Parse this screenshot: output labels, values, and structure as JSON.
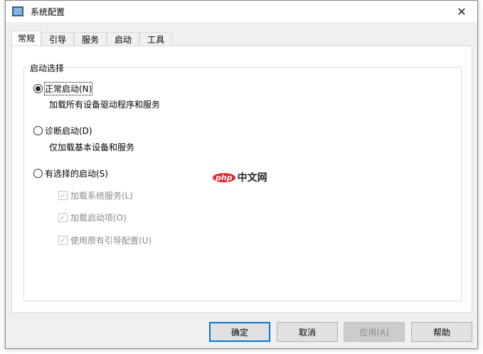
{
  "window": {
    "title": "系统配置",
    "close": "✕"
  },
  "tabs": [
    "常规",
    "引导",
    "服务",
    "启动",
    "工具"
  ],
  "group": {
    "legend": "启动选择"
  },
  "options": [
    {
      "label": "正常启动(N)",
      "description": "加载所有设备驱动程序和服务",
      "selected": true
    },
    {
      "label": "诊断启动(D)",
      "description": "仅加载基本设备和服务",
      "selected": false
    },
    {
      "label": "有选择的启动(S)",
      "selected": false
    }
  ],
  "checkboxes": [
    {
      "label": "加载系统服务(L)",
      "checked": true,
      "disabled": true
    },
    {
      "label": "加载启动项(O)",
      "checked": true,
      "disabled": true
    },
    {
      "label": "使用原有引导配置(U)",
      "checked": true,
      "disabled": true
    }
  ],
  "buttons": {
    "ok": "确定",
    "cancel": "取消",
    "apply": "应用(A)",
    "help": "帮助"
  },
  "watermark": {
    "logo": "php",
    "text": "中文网"
  }
}
